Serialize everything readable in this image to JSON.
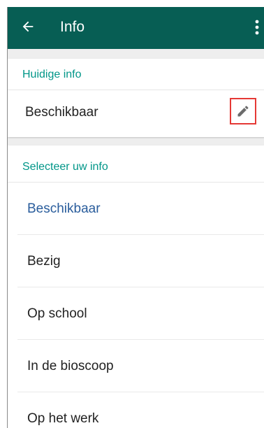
{
  "colors": {
    "toolbar": "#075e54",
    "accent": "#009688",
    "selected_text": "#2a5d9c",
    "highlight_border": "#e53935"
  },
  "appbar": {
    "title": "Info",
    "back_icon": "arrow-left-icon",
    "menu_icon": "more-vert-icon"
  },
  "current": {
    "section_title": "Huidige info",
    "status": "Beschikbaar",
    "edit_icon": "pencil-icon"
  },
  "select": {
    "section_title": "Selecteer uw info",
    "options": [
      {
        "label": "Beschikbaar",
        "selected": true
      },
      {
        "label": "Bezig",
        "selected": false
      },
      {
        "label": "Op school",
        "selected": false
      },
      {
        "label": "In de bioscoop",
        "selected": false
      },
      {
        "label": "Op het werk",
        "selected": false
      }
    ]
  }
}
